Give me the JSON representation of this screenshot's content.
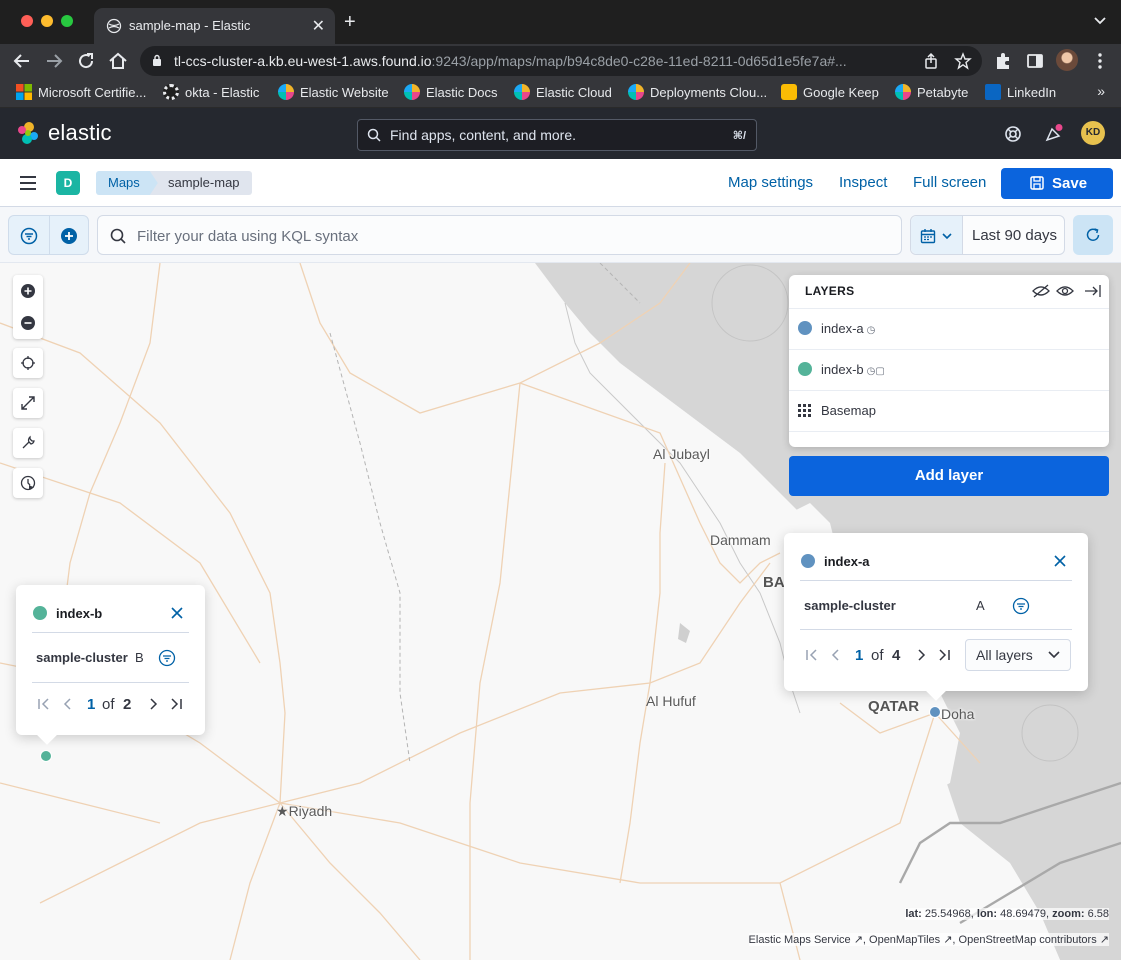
{
  "browser": {
    "tab_title": "sample-map - Elastic",
    "url_main": "tl-ccs-cluster-a.kb.eu-west-1.aws.found.io",
    "url_rest": ":9243/app/maps/map/b94c8de0-c28e-11ed-8211-0d65d1e5fe7a#...",
    "bookmarks": [
      {
        "label": "Microsoft Certifie...",
        "color": "#f25022"
      },
      {
        "label": "okta - Elastic",
        "color": "#ffffff"
      },
      {
        "label": "Elastic Website",
        "color": "#f0b429"
      },
      {
        "label": "Elastic Docs",
        "color": "#f0b429"
      },
      {
        "label": "Elastic Cloud",
        "color": "#f0b429"
      },
      {
        "label": "Deployments Clou...",
        "color": "#f0b429"
      },
      {
        "label": "Google Keep",
        "color": "#fbbc04"
      },
      {
        "label": "Petabyte",
        "color": "#f0b429"
      },
      {
        "label": "LinkedIn",
        "color": "#0a66c2"
      }
    ],
    "bookmarks_more": "»"
  },
  "kibana": {
    "brand": "elastic",
    "search_placeholder": "Find apps, content, and more.",
    "search_shortcut": "⌘/",
    "avatar_initials": "KD"
  },
  "appbar": {
    "space_initial": "D",
    "breadcrumbs": [
      "Maps",
      "sample-map"
    ],
    "links": [
      "Map settings",
      "Inspect",
      "Full screen"
    ],
    "save_label": "Save"
  },
  "querybar": {
    "placeholder": "Filter your data using KQL syntax",
    "date_label": "Last 90 days"
  },
  "map": {
    "labels": {
      "al_jubayl": "Al Jubayl",
      "dammam": "Dammam",
      "ba": "BA",
      "al_hufuf": "Al Hufuf",
      "qatar": "QATAR",
      "doha": "Doha",
      "riyadh": "Riyadh"
    },
    "layers_title": "LAYERS",
    "layers": [
      {
        "name": "index-a",
        "color": "#6092c0",
        "icons": "◷"
      },
      {
        "name": "index-b",
        "color": "#54b399",
        "icons": "◷▢"
      },
      {
        "name": "Basemap",
        "color": "",
        "icons": ""
      }
    ],
    "add_layer_label": "Add layer",
    "coords": {
      "lat_label": "lat:",
      "lat": "25.54968,",
      "lon_label": "lon:",
      "lon": "48.69479,",
      "zoom_label": "zoom:",
      "zoom": "6.58"
    },
    "attribution": "Elastic Maps Service ↗, OpenMapTiles ↗, OpenStreetMap contributors ↗"
  },
  "tooltip_a": {
    "title": "index-a",
    "color": "#6092c0",
    "field": "sample-cluster",
    "value": "A",
    "page": "1",
    "of": "of",
    "total": "4",
    "select_label": "All layers"
  },
  "tooltip_b": {
    "title": "index-b",
    "color": "#54b399",
    "field": "sample-cluster",
    "value": "B",
    "page": "1",
    "of": "of",
    "total": "2"
  }
}
